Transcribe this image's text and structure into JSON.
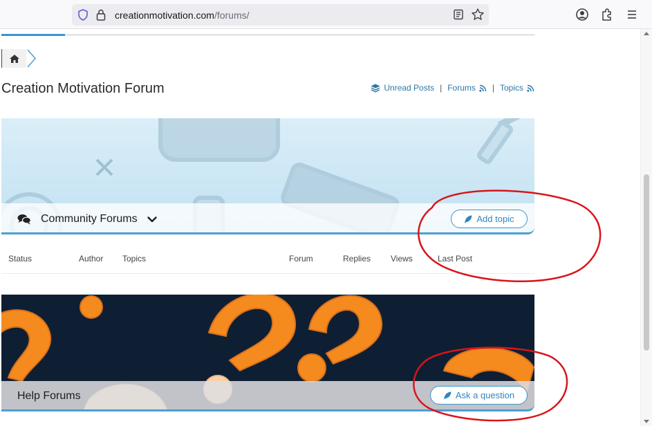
{
  "browser": {
    "url_domain": "creationmotivation.com",
    "url_path": "/forums/",
    "icons": [
      "shield-icon",
      "lock-icon",
      "reader-view-icon",
      "bookmark-star-icon",
      "account-icon",
      "extensions-icon",
      "menu-icon"
    ]
  },
  "breadcrumb": {
    "icon": "home-icon"
  },
  "page": {
    "title": "Creation Motivation Forum",
    "links": {
      "unread": "Unread Posts",
      "forums": "Forums",
      "topics": "Topics",
      "separator": "|"
    }
  },
  "community": {
    "label": "Community Forums",
    "add_topic": "Add topic"
  },
  "table": {
    "columns": [
      "Status",
      "Author",
      "Topics",
      "Forum",
      "Replies",
      "Views",
      "Last Post"
    ]
  },
  "help": {
    "label": "Help Forums",
    "ask": "Ask a question"
  },
  "colors": {
    "accent": "#3a95cc",
    "link": "#2e77a8",
    "annotation": "#d9141b",
    "help_bg": "#0f1f33",
    "question_mark": "#f58a1f"
  }
}
